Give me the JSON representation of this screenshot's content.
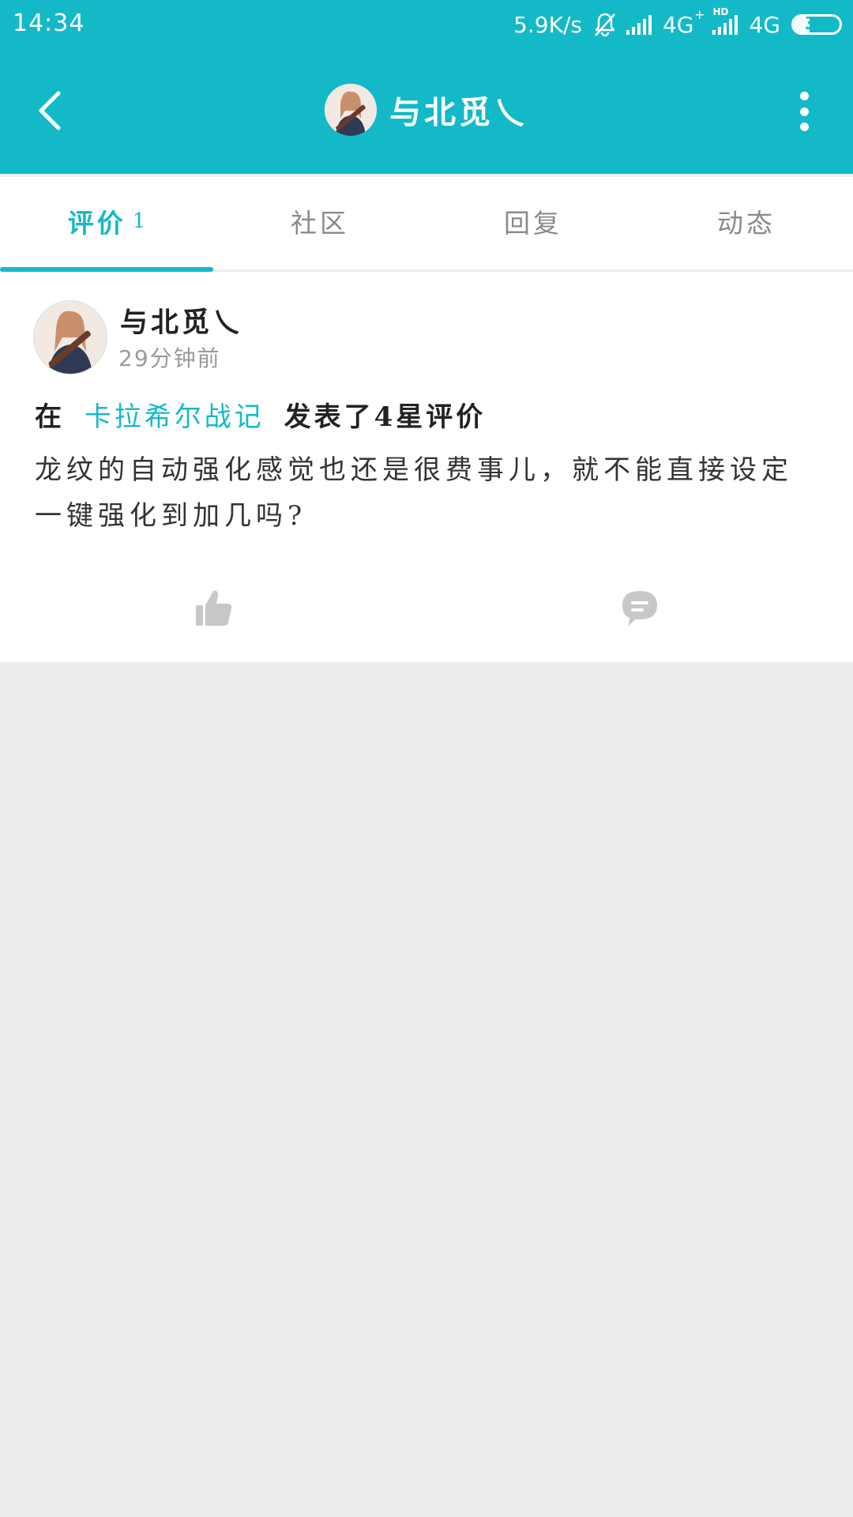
{
  "status_bar": {
    "time": "14:34",
    "network_speed": "5.9K/s",
    "sim1_network": "4G",
    "sim1_plus": "+",
    "hd_label": "HD",
    "sim2_network": "4G",
    "battery_level": "35",
    "battery_fraction": 0.35,
    "icons": [
      "bell-off-icon",
      "signal-icon",
      "signal-icon",
      "battery-icon"
    ]
  },
  "toolbar": {
    "title": "与北觅乀",
    "back_icon": "chevron-left-icon",
    "more_icon": "more-vertical-icon"
  },
  "tabs": [
    {
      "label": "评价",
      "count": "1",
      "active": true
    },
    {
      "label": "社区",
      "count": "",
      "active": false
    },
    {
      "label": "回复",
      "count": "",
      "active": false
    },
    {
      "label": "动态",
      "count": "",
      "active": false
    }
  ],
  "post": {
    "author": "与北觅乀",
    "time": "29分钟前",
    "review_prefix": "在",
    "game_name": "卡拉希尔战记",
    "review_suffix": "发表了4星评价",
    "body": "龙纹的自动强化感觉也还是很费事儿，就不能直接设定一键强化到加几吗?",
    "like_icon": "thumbs-up-icon",
    "comment_icon": "comment-icon"
  },
  "colors": {
    "accent": "#14b9c8",
    "page_bg": "#ededed",
    "muted_text": "#9a9a9a",
    "icon_gray": "#c8c8c8"
  }
}
